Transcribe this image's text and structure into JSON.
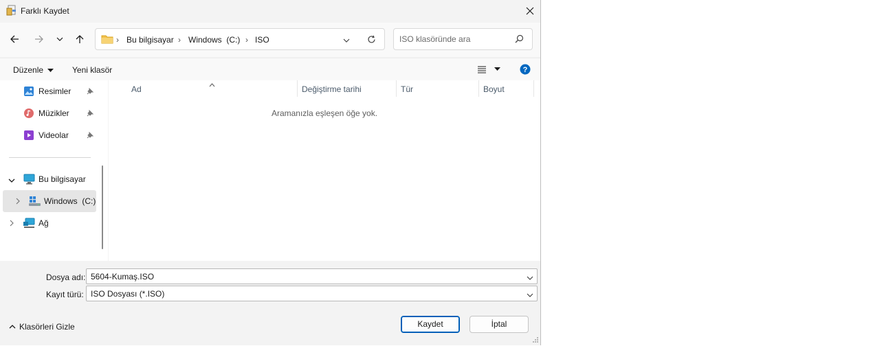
{
  "window": {
    "title": "Farklı Kaydet"
  },
  "nav": {
    "breadcrumb": [
      "Bu bilgisayar",
      "Windows  (C:)",
      "ISO"
    ],
    "search_placeholder": "ISO klasöründe ara"
  },
  "toolbar": {
    "organize": "Düzenle",
    "new_folder": "Yeni klasör"
  },
  "sidebar": {
    "items": [
      {
        "label": "Resimler",
        "icon": "pictures-icon",
        "pinned": true
      },
      {
        "label": "Müzikler",
        "icon": "music-icon",
        "pinned": true
      },
      {
        "label": "Videolar",
        "icon": "videos-icon",
        "pinned": true
      },
      {
        "label": "Bu bilgisayar",
        "icon": "computer-icon",
        "expanded": true
      },
      {
        "label": "Windows  (C:)",
        "icon": "drive-icon",
        "selected": true
      },
      {
        "label": "Ağ",
        "icon": "network-icon"
      }
    ]
  },
  "columns": [
    "Ad",
    "Değiştirme tarihi",
    "Tür",
    "Boyut"
  ],
  "empty_message": "Aramanızla eşleşen öğe yok.",
  "form": {
    "filename_label": "Dosya adı:",
    "filename_value": "5604-Kumaş.ISO",
    "type_label": "Kayıt türü:",
    "type_value": "ISO Dosyası (*.ISO)"
  },
  "footer": {
    "hide_folders": "Klasörleri Gizle",
    "save": "Kaydet",
    "cancel": "İptal"
  },
  "colors": {
    "accent": "#005fb8",
    "help": "#0067c0"
  }
}
